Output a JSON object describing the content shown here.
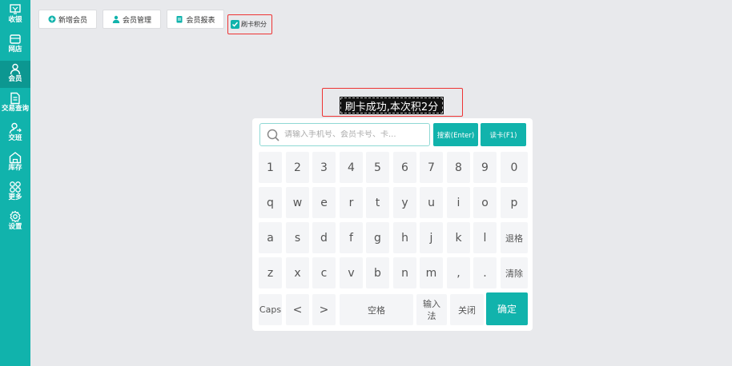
{
  "sidebar": {
    "items": [
      {
        "label": "收银",
        "icon": "cashier-icon"
      },
      {
        "label": "网店",
        "icon": "store-icon"
      },
      {
        "label": "会员",
        "icon": "member-icon",
        "active": true
      },
      {
        "label": "交易查询",
        "icon": "document-icon"
      },
      {
        "label": "交班",
        "icon": "shift-icon"
      },
      {
        "label": "库存",
        "icon": "warehouse-icon"
      },
      {
        "label": "更多",
        "icon": "grid-icon"
      },
      {
        "label": "设置",
        "icon": "gear-icon"
      }
    ]
  },
  "toolbar": {
    "add_member": "新增会员",
    "manage_members": "会员管理",
    "member_report": "会员报表",
    "swipe_points_label": "刷卡积分",
    "swipe_points_checked": true
  },
  "toast": {
    "message": "刷卡成功,本次积2分"
  },
  "keyboard": {
    "search_placeholder": "请输入手机号、会员卡号、卡...",
    "search_button": "搜索(Enter)",
    "read_card_button": "读卡(F1)",
    "row1": [
      "1",
      "2",
      "3",
      "4",
      "5",
      "6",
      "7",
      "8",
      "9",
      "0"
    ],
    "row2": [
      "q",
      "w",
      "e",
      "r",
      "t",
      "y",
      "u",
      "i",
      "o",
      "p"
    ],
    "row3": [
      "a",
      "s",
      "d",
      "f",
      "g",
      "h",
      "j",
      "k",
      "l",
      "退格"
    ],
    "row4": [
      "z",
      "x",
      "c",
      "v",
      "b",
      "n",
      "m",
      ",",
      ".",
      "清除"
    ],
    "caps": "Caps",
    "left": "<",
    "right": ">",
    "space": "空格",
    "ime": "输入法",
    "close": "关闭",
    "confirm": "确定"
  },
  "colors": {
    "accent": "#11b3ac",
    "alert_border": "#ee3333"
  }
}
